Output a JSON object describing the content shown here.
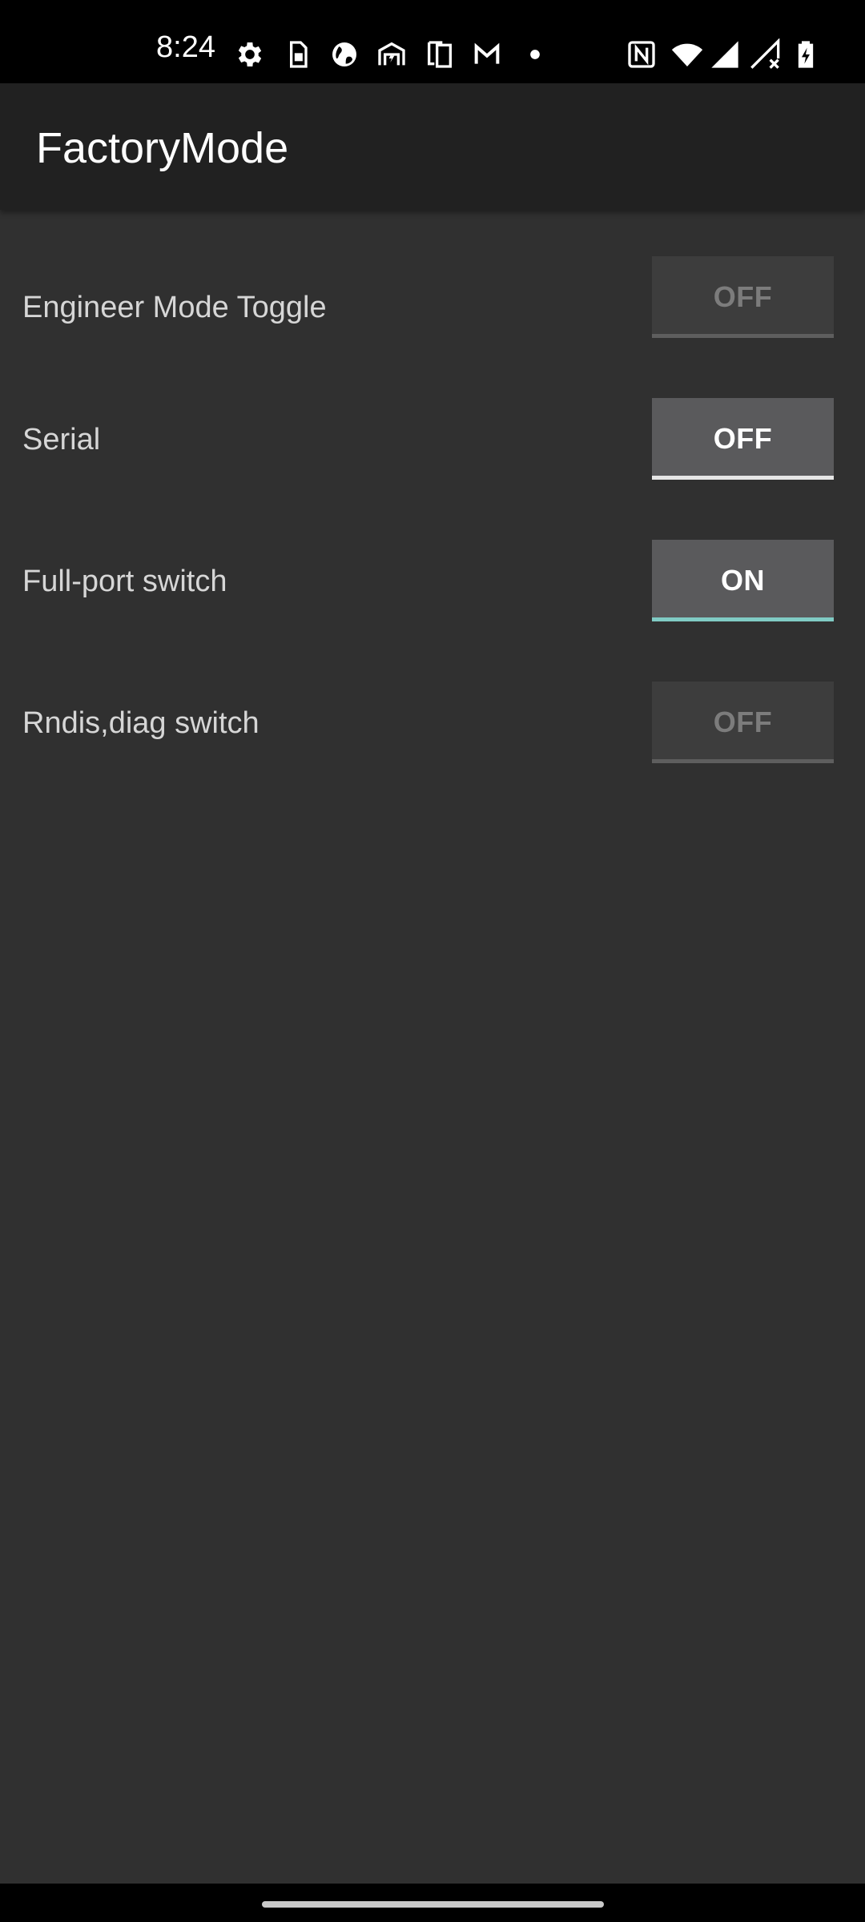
{
  "status_bar": {
    "time": "8:24",
    "left_icons": [
      "settings-icon",
      "sim-card-icon",
      "globe-icon",
      "wireless-charging-icon",
      "devices-icon",
      "gmail-icon",
      "dot-icon"
    ],
    "right_icons": [
      "nfc-icon",
      "wifi-icon",
      "cell-signal-icon",
      "no-signal-icon",
      "battery-charging-icon"
    ]
  },
  "app_bar": {
    "title": "FactoryMode"
  },
  "settings": [
    {
      "label": "Engineer Mode Toggle",
      "state": "OFF",
      "enabled": false
    },
    {
      "label": "Serial",
      "state": "OFF",
      "enabled": true
    },
    {
      "label": "Full-port switch",
      "state": "ON",
      "enabled": true
    },
    {
      "label": "Rndis,diag switch",
      "state": "OFF",
      "enabled": false
    }
  ],
  "colors": {
    "background": "#303030",
    "app_bar": "#212121",
    "accent": "#80cbc4"
  }
}
